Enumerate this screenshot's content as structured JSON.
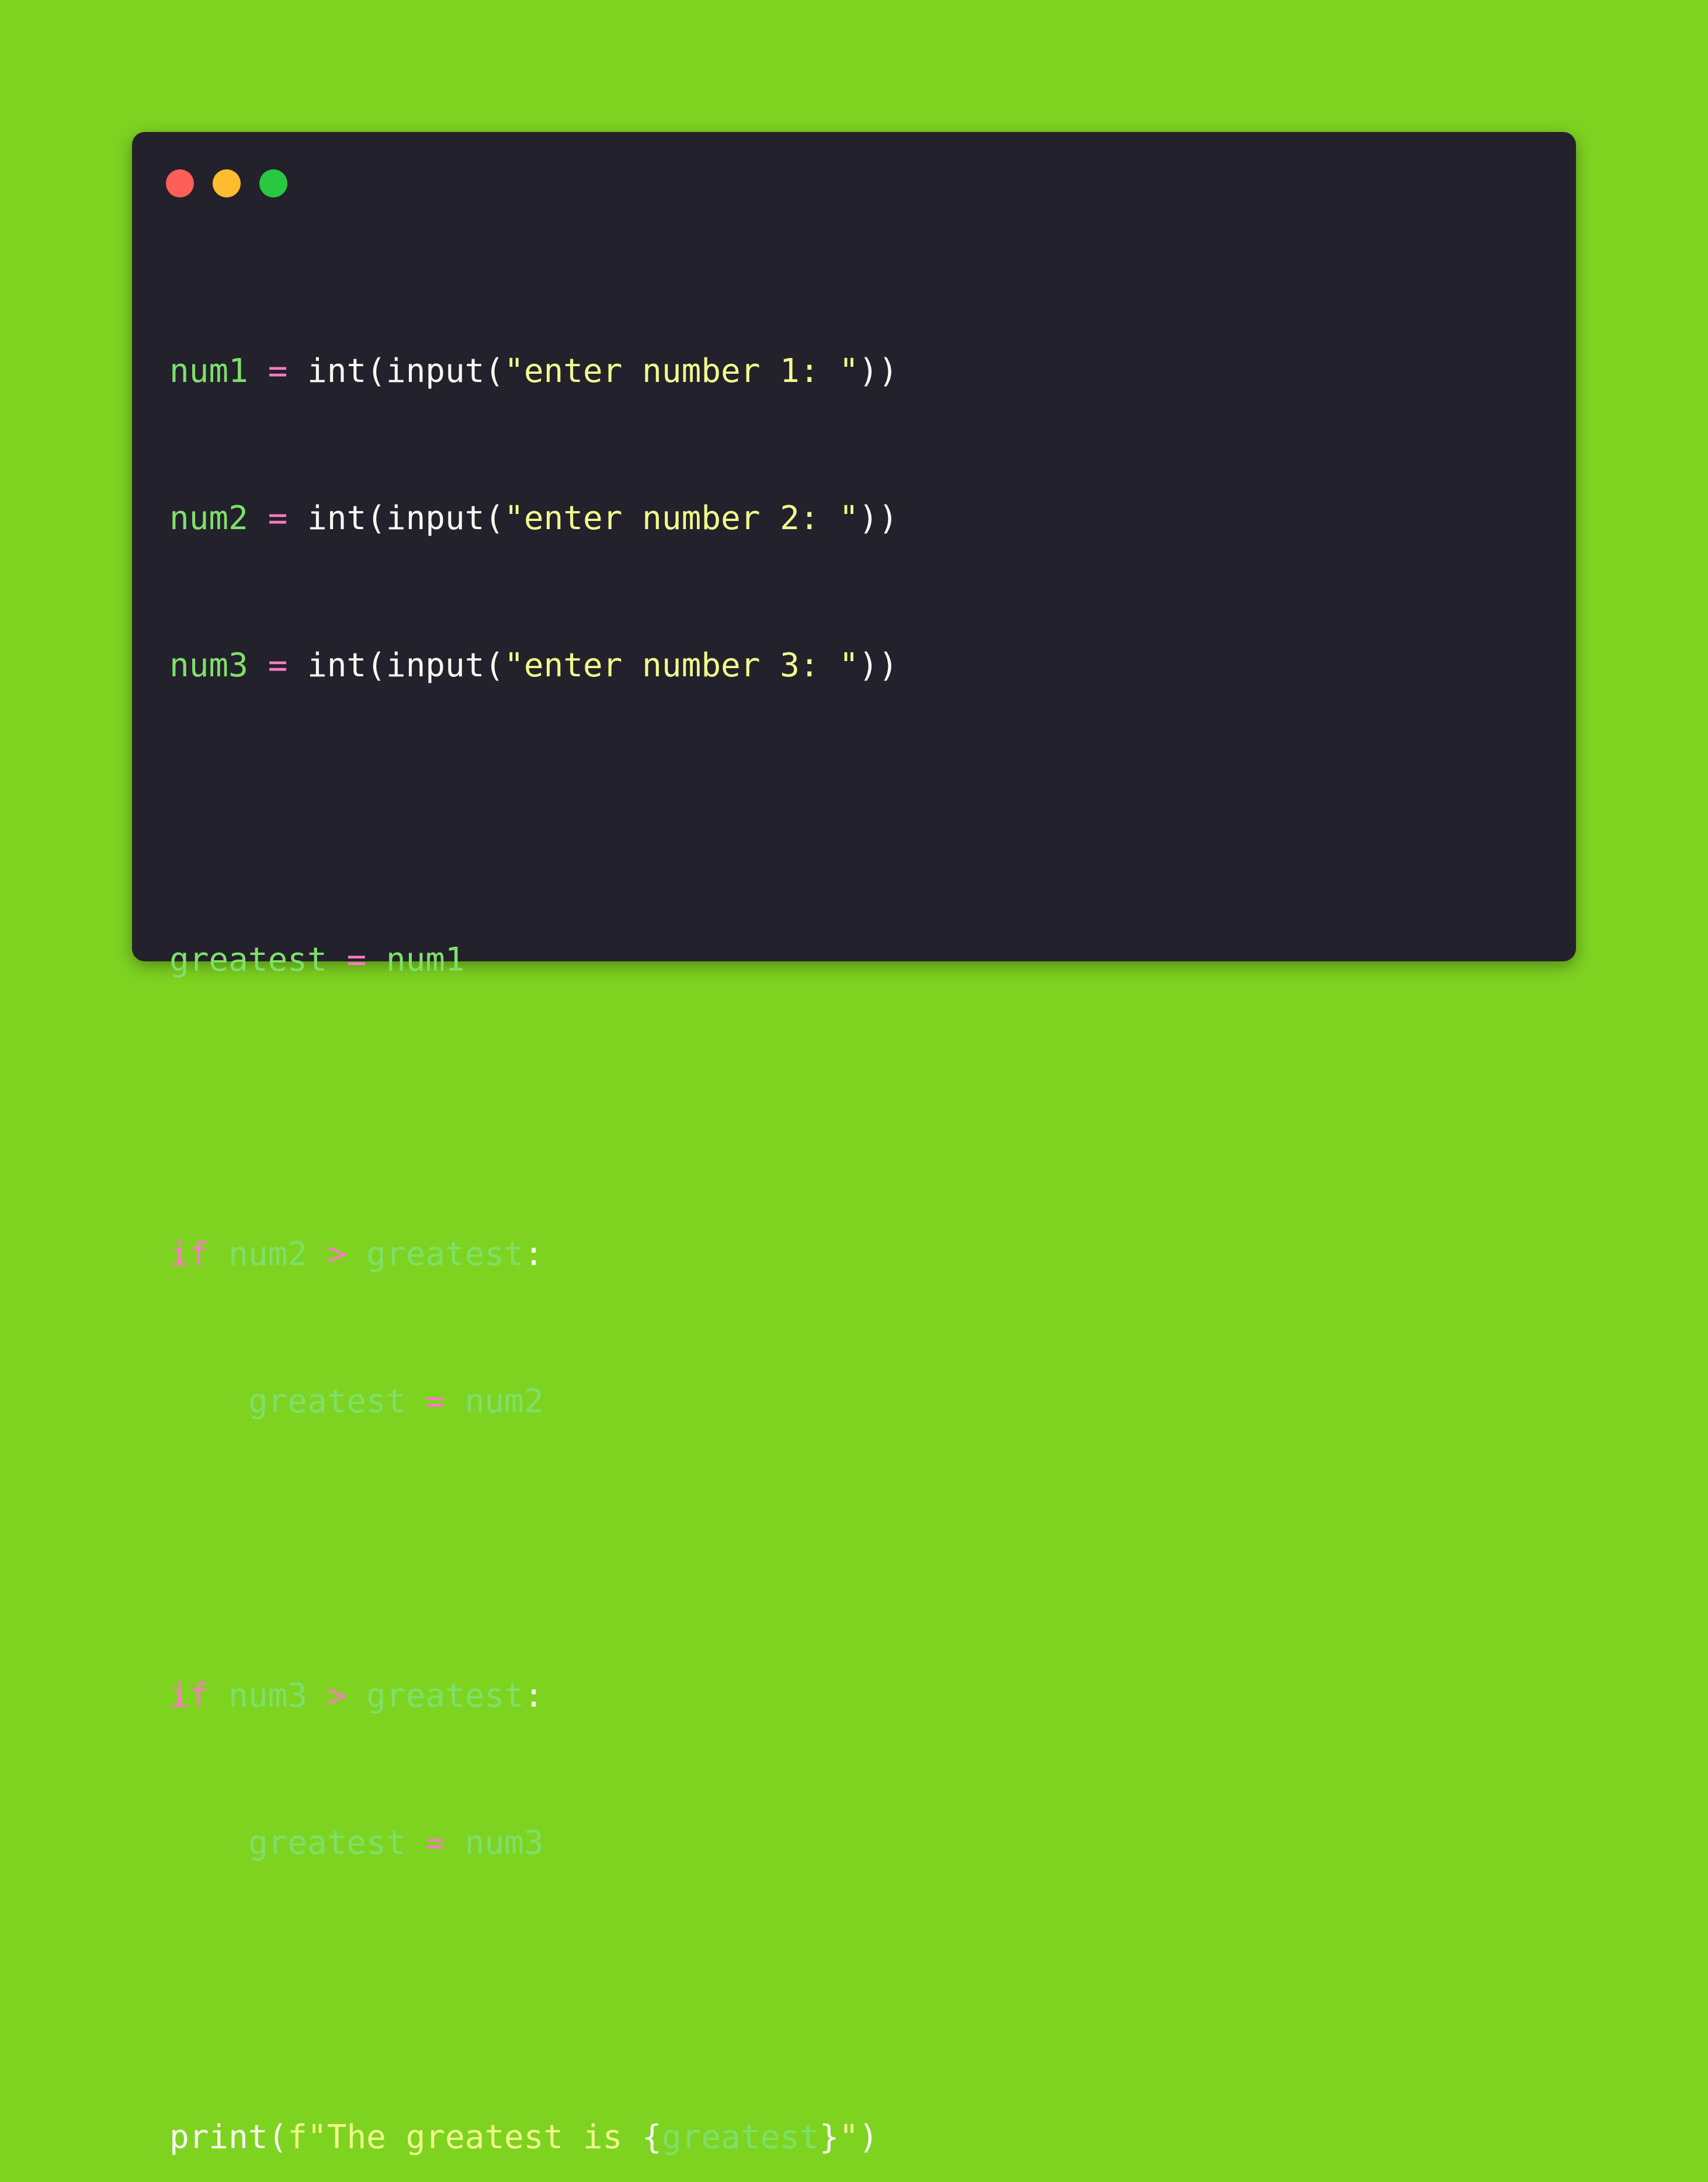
{
  "colors": {
    "background": "#7ed321",
    "window": "#23212b",
    "dot_close": "#ff5f57",
    "dot_minimize": "#febc2e",
    "dot_maximize": "#28c840",
    "variable": "#7ee06a",
    "operator": "#ff79c6",
    "keyword": "#ff79c6",
    "function": "#f8f8f2",
    "string": "#f1fa8c"
  },
  "window_controls": [
    "close-dot",
    "minimize-dot",
    "maximize-dot"
  ],
  "code": {
    "line1": {
      "var": "num1",
      "op": "=",
      "fn": "int(input(",
      "str": "\"enter number 1: \"",
      "close": "))"
    },
    "line2": {
      "var": "num2",
      "op": "=",
      "fn": "int(input(",
      "str": "\"enter number 2: \"",
      "close": "))"
    },
    "line3": {
      "var": "num3",
      "op": "=",
      "fn": "int(input(",
      "str": "\"enter number 3: \"",
      "close": "))"
    },
    "line5": {
      "var": "greatest",
      "op": "=",
      "value": "num1"
    },
    "line7": {
      "kw": "if",
      "left": "num2",
      "op": ">",
      "right": "greatest",
      "colon": ":"
    },
    "line8": {
      "indent": "    ",
      "var": "greatest",
      "op": "=",
      "value": "num2"
    },
    "line10": {
      "kw": "if",
      "left": "num3",
      "op": ">",
      "right": "greatest",
      "colon": ":"
    },
    "line11": {
      "indent": "    ",
      "var": "greatest",
      "op": "=",
      "value": "num3"
    },
    "line13": {
      "fn": "print(",
      "str_start": "f\"The greatest is ",
      "brace_open": "{",
      "var": "greatest",
      "brace_close": "}",
      "str_end": "\"",
      "close": ")"
    }
  }
}
